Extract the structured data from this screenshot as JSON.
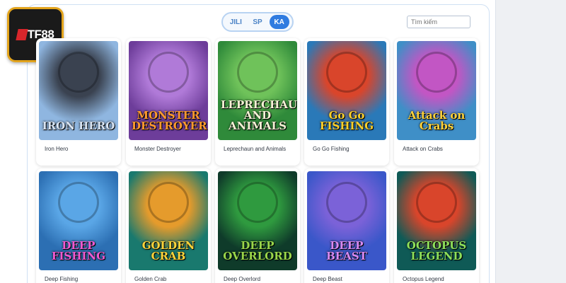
{
  "brand": {
    "logo_text": "TF88"
  },
  "provider_tabs": [
    {
      "label": "JILI",
      "active": false
    },
    {
      "label": "SP",
      "active": false
    },
    {
      "label": "KA",
      "active": true
    }
  ],
  "search": {
    "placeholder": "Tìm kiếm"
  },
  "games": [
    {
      "name": "Iron Hero",
      "art_title": "IRON HERO",
      "bg": "#8fb6e0",
      "fg": "#3a4250",
      "title_color": "#d9e4f2"
    },
    {
      "name": "Monster Destroyer",
      "art_title": "MONSTER DESTROYER",
      "bg": "#6d3d9a",
      "fg": "#b07ad8",
      "title_color": "#ff9a2e"
    },
    {
      "name": "Leprechaun and Animals",
      "art_title": "LEPRECHAUN AND ANIMALS",
      "bg": "#2f8a3a",
      "fg": "#6fc25a",
      "title_color": "#f6f1d6"
    },
    {
      "name": "Go Go Fishing",
      "art_title": "Go Go FISHING",
      "bg": "#2a79b8",
      "fg": "#d9452b",
      "title_color": "#ffd02a"
    },
    {
      "name": "Attack on Crabs",
      "art_title": "Attack on Crabs",
      "bg": "#3f8fc7",
      "fg": "#c256c4",
      "title_color": "#ffd23a"
    },
    {
      "name": "Deep Fishing",
      "art_title": "DEEP FISHING",
      "bg": "#2c6fb3",
      "fg": "#5aa6e6",
      "title_color": "#f05ad0"
    },
    {
      "name": "Golden Crab",
      "art_title": "GOLDEN CRAB",
      "bg": "#19796e",
      "fg": "#e59b2c",
      "title_color": "#ffd43a"
    },
    {
      "name": "Deep Overlord",
      "art_title": "DEEP OVERLORD",
      "bg": "#0f3b2a",
      "fg": "#2f9a3f",
      "title_color": "#9ad64a"
    },
    {
      "name": "Deep Beast",
      "art_title": "DEEP BEAST",
      "bg": "#3a57c9",
      "fg": "#7b62d8",
      "title_color": "#d98af2"
    },
    {
      "name": "Octopus Legend",
      "art_title": "OCTOPUS LEGEND",
      "bg": "#0f5a56",
      "fg": "#d9452b",
      "title_color": "#8ee05a"
    }
  ]
}
